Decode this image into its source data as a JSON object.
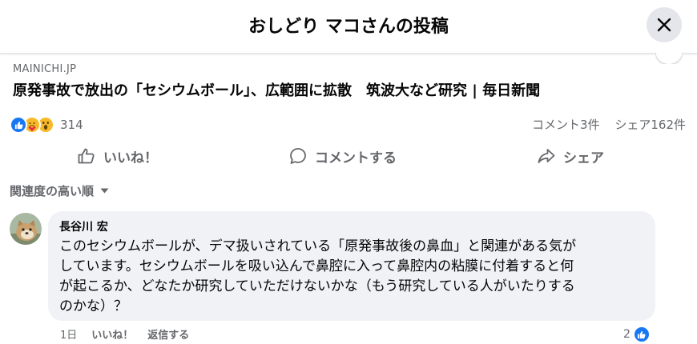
{
  "header": {
    "title": "おしどり マコさんの投稿"
  },
  "link_preview": {
    "domain": "MAINICHI.JP",
    "title": "原発事故で放出の「セシウムボール」、広範囲に拡散　筑波大など研究 | 毎日新聞"
  },
  "reactions": {
    "icons": [
      "like-icon",
      "care-icon",
      "wow-icon"
    ],
    "count": "314",
    "comments": "コメント3件",
    "shares": "シェア162件"
  },
  "actions": {
    "like": "いいね！",
    "comment": "コメントする",
    "share": "シェア"
  },
  "sort": {
    "label": "関連度の高い順"
  },
  "comment": {
    "author": "長谷川 宏",
    "text": "このセシウムボールが、デマ扱いされている「原発事故後の鼻血」と関連がある気が\nしています。セシウムボールを吸い込んで鼻腔に入って鼻腔内の粘膜に付着すると何\nが起こるか、どなたか研究していただけないかな（もう研究している人がいたりする\nのかな）？",
    "time": "1日",
    "like": "いいね！",
    "reply": "返信する",
    "reaction_count": "2"
  },
  "colors": {
    "facebook_blue": "#1877f2",
    "secondary_text": "#65676b",
    "bubble": "#f0f2f5"
  }
}
